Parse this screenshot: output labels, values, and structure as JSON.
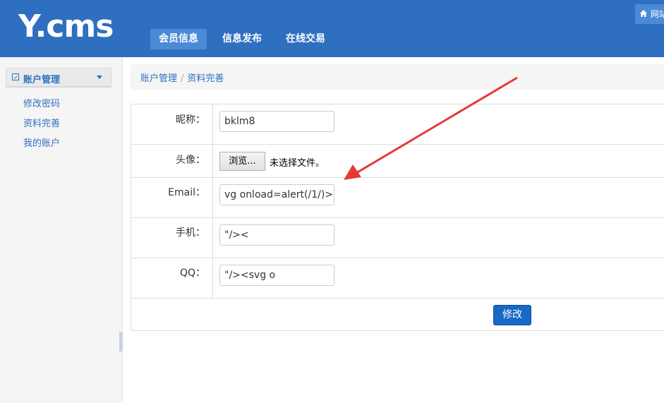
{
  "header": {
    "logo": "Y.cms",
    "nav": [
      "会员信息",
      "信息发布",
      "在线交易"
    ],
    "active_nav": 0,
    "home_label": "网站"
  },
  "sidebar": {
    "group_label": "账户管理",
    "links": [
      "修改密码",
      "资料完善",
      "我的账户"
    ]
  },
  "breadcrumb": {
    "items": [
      "账户管理",
      "资料完善"
    ]
  },
  "form": {
    "nickname_label": "昵称：",
    "nickname_value": "bklm8",
    "avatar_label": "头像：",
    "browse_label": "浏览...",
    "no_file_text": "未选择文件。",
    "email_label": "Email：",
    "email_value": "vg onload=alert(/1/)>",
    "phone_label": "手机：",
    "phone_value": "\"/><",
    "qq_label": "QQ：",
    "qq_value": "\"/><svg o",
    "submit_label": "修改"
  },
  "colors": {
    "header_bg": "#2f6fc0",
    "accent": "#2f6fc0",
    "button": "#1869c4",
    "annotation": "#e53935"
  }
}
